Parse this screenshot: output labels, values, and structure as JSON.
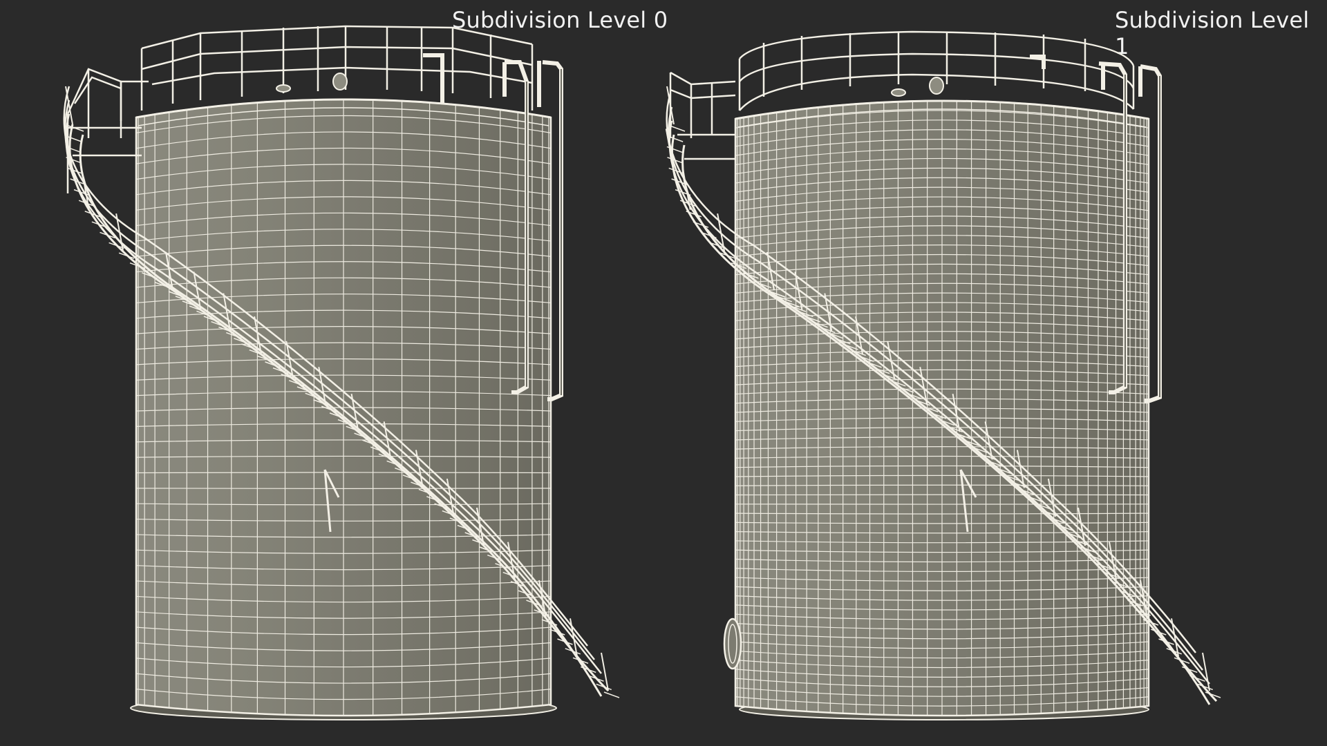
{
  "panels": [
    {
      "label": "Subdivision Level 0",
      "grid_cols": 22,
      "grid_rows": 38
    },
    {
      "label": "Subdivision Level 1",
      "grid_cols": 44,
      "grid_rows": 64
    }
  ],
  "colors": {
    "background": "#2a2a2a",
    "tank_surface": "#7e7d72",
    "wireframe": "#f3f0e6",
    "label_text": "#f2f2f2"
  }
}
